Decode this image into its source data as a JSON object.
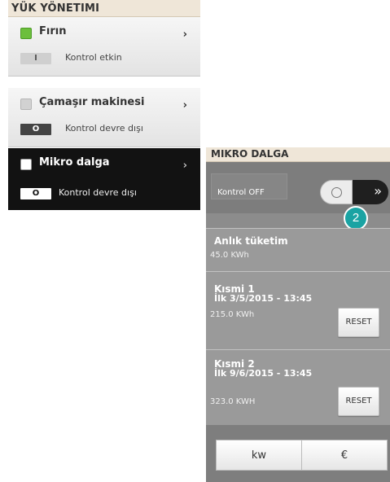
{
  "load_management": {
    "title": "YÜK YÖNETIMI",
    "devices": [
      {
        "name": "Fırın",
        "badge": "I",
        "status": "Kontrol etkin",
        "state_color": "#6cbf3c"
      },
      {
        "name": "Çamaşır makinesi",
        "badge": "O",
        "status": "Kontrol devre dışı",
        "state_color": "#d2d2d2"
      },
      {
        "name": "Mikro dalga",
        "badge": "O",
        "status": "Kontrol devre dışı",
        "state_color": "#ffffff"
      }
    ],
    "arrow": "›"
  },
  "microwave": {
    "title": "MIKRO DALGA",
    "control_label": "Kontrol OFF",
    "toggle_arrow": "»",
    "callout_number": "2",
    "instant": {
      "title": "Anlık tüketim",
      "value": "45.0 KWh"
    },
    "partial1": {
      "title": "Kısmi 1",
      "start": "İlk   3/5/2015 - 13:45",
      "value": "215.0 KWh",
      "reset": "RESET"
    },
    "partial2": {
      "title": "Kısmi 2",
      "start": "İlk   9/6/2015 - 13:45",
      "value": "323.0 KWH",
      "reset": "RESET"
    },
    "units": {
      "kw": "kw",
      "eur": "€"
    }
  },
  "colors": {
    "accent_teal": "#1aa3a3",
    "header_beige": "#efe6d8",
    "active_green": "#6cbf3c"
  }
}
